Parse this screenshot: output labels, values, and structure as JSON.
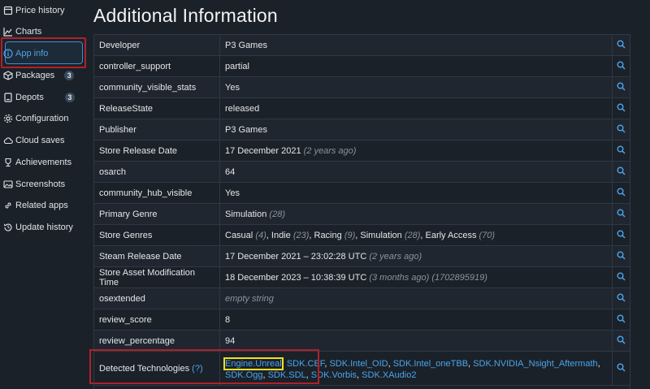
{
  "sidebar": {
    "items": [
      {
        "label": "Price history",
        "icon": "receipt-icon"
      },
      {
        "label": "Charts",
        "icon": "line-chart-icon"
      },
      {
        "label": "App info",
        "icon": "info-icon",
        "active": true
      },
      {
        "label": "Packages",
        "icon": "package-icon",
        "badge": "3"
      },
      {
        "label": "Depots",
        "icon": "drive-icon",
        "badge": "3"
      },
      {
        "label": "Configuration",
        "icon": "gear-icon"
      },
      {
        "label": "Cloud saves",
        "icon": "cloud-icon"
      },
      {
        "label": "Achievements",
        "icon": "trophy-icon"
      },
      {
        "label": "Screenshots",
        "icon": "image-icon"
      },
      {
        "label": "Related apps",
        "icon": "link-icon"
      },
      {
        "label": "Update history",
        "icon": "history-icon"
      }
    ]
  },
  "main": {
    "title": "Additional Information",
    "rows": [
      {
        "key": "Developer",
        "value": "P3 Games"
      },
      {
        "key": "controller_support",
        "value": "partial"
      },
      {
        "key": "community_visible_stats",
        "value": "Yes"
      },
      {
        "key": "ReleaseState",
        "value": "released"
      },
      {
        "key": "Publisher",
        "value": "P3 Games"
      },
      {
        "key": "Store Release Date",
        "value": "17 December 2021",
        "note": "(2 years ago)"
      },
      {
        "key": "osarch",
        "value": "64"
      },
      {
        "key": "community_hub_visible",
        "value": "Yes"
      },
      {
        "key": "Primary Genre",
        "value": "Simulation",
        "note": "(28)"
      },
      {
        "key": "Store Genres",
        "genres": [
          {
            "name": "Casual",
            "id": "(4)"
          },
          {
            "name": "Indie",
            "id": "(23)"
          },
          {
            "name": "Racing",
            "id": "(9)"
          },
          {
            "name": "Simulation",
            "id": "(28)"
          },
          {
            "name": "Early Access",
            "id": "(70)"
          }
        ]
      },
      {
        "key": "Steam Release Date",
        "value": "17 December 2021 – 23:02:28 UTC",
        "note": "(2 years ago)"
      },
      {
        "key": "Store Asset Modification Time",
        "value": "18 December 2023 – 10:38:39 UTC",
        "note": "(3 months ago) (1702895919)"
      },
      {
        "key": "osextended",
        "muted_value": "empty string"
      },
      {
        "key": "review_score",
        "value": "8"
      },
      {
        "key": "review_percentage",
        "value": "94"
      }
    ],
    "detected": {
      "key": "Detected Technologies",
      "help": "(?)",
      "techs": [
        "Engine.Unreal",
        "SDK.CEF",
        "SDK.Intel_OID",
        "SDK.Intel_oneTBB",
        "SDK.NVIDIA_Nsight_Aftermath",
        "SDK.Ogg",
        "SDK.SDL",
        "SDK.Vorbis",
        "SDK.XAudio2"
      ]
    },
    "search_icon": "magnifier-icon"
  },
  "colors": {
    "background": "#1b2129",
    "accent": "#4aa5ea",
    "highlight_red": "#b0212a",
    "highlight_yellow": "#f3e01a"
  }
}
